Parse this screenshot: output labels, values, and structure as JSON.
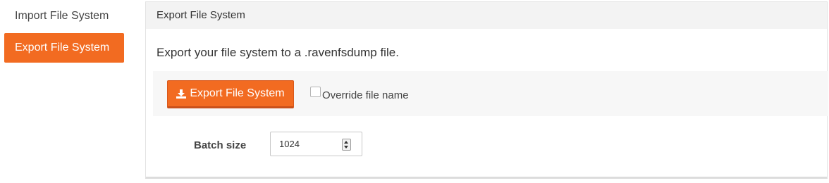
{
  "sidebar": {
    "items": [
      {
        "label": "Import File System",
        "active": false
      },
      {
        "label": "Export File System",
        "active": true
      }
    ]
  },
  "panel": {
    "title": "Export File System",
    "intro": "Export your file system to a .ravenfsdump file.",
    "export_button": {
      "label": "Export File System",
      "icon": "download-icon"
    },
    "override": {
      "label": "Override file name",
      "checked": false
    },
    "batch": {
      "label": "Batch size",
      "value": "1024"
    }
  },
  "colors": {
    "accent": "#f26b21",
    "panel_heading_bg": "#f3f3f3",
    "action_bar_bg": "#f7f7f7"
  }
}
